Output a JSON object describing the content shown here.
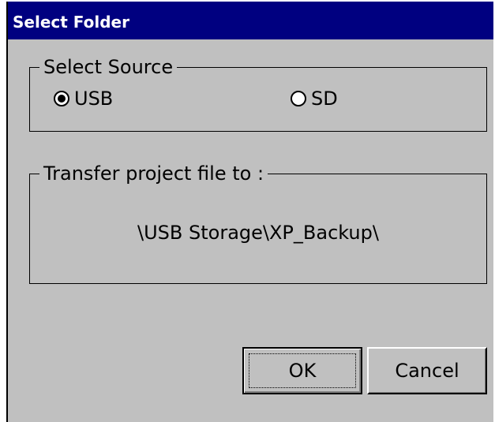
{
  "window": {
    "title": "Select Folder"
  },
  "source_group": {
    "legend": "Select Source",
    "options": [
      {
        "label": "USB",
        "checked": true
      },
      {
        "label": "SD",
        "checked": false
      }
    ]
  },
  "transfer_group": {
    "legend": "Transfer project file to :",
    "path": "\\USB Storage\\XP_Backup\\"
  },
  "buttons": {
    "ok_label": "OK",
    "cancel_label": "Cancel"
  },
  "colors": {
    "titlebar": "#000080",
    "window_bg": "#c0c0c0",
    "title_text": "#ffffff"
  }
}
